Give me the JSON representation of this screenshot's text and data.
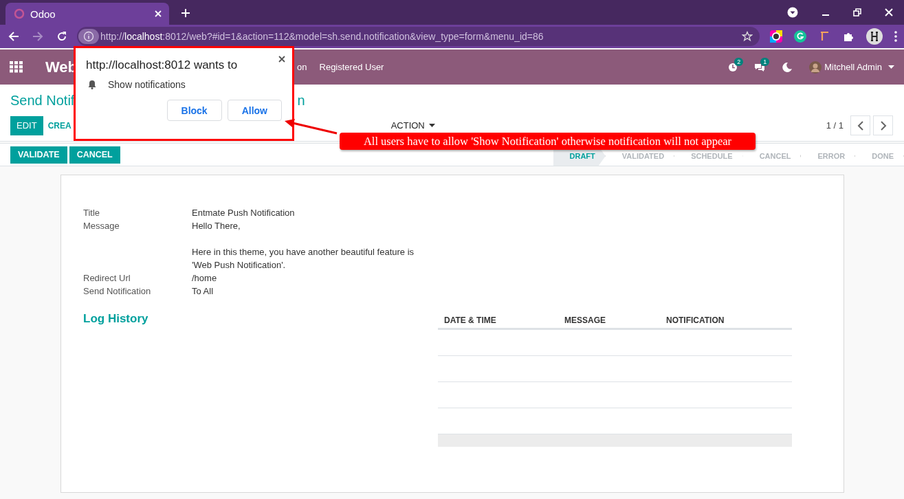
{
  "browser": {
    "tab_title": "Odoo",
    "url_host": "localhost",
    "url_rest": ":8012/web?#id=1&action=112&model=sh.send.notification&view_type=form&menu_id=86",
    "url_scheme": "http://"
  },
  "navbar": {
    "app_name": "Web",
    "menu_items": [
      "on",
      "Registered User"
    ],
    "activity_count": "2",
    "message_count": "1",
    "user": "Mitchell Admin"
  },
  "control_panel": {
    "breadcrumb": [
      "Send Notif",
      "n"
    ],
    "buttons": [
      "EDIT",
      "CREA"
    ],
    "action": "ACTION",
    "pager": "1 / 1"
  },
  "statusbar": {
    "buttons": [
      "VALIDATE",
      "CANCEL"
    ],
    "stages": [
      {
        "label": "DRAFT",
        "selected": true
      },
      {
        "label": "VALIDATED",
        "selected": false
      },
      {
        "label": "SCHEDULE",
        "selected": false
      },
      {
        "label": "CANCEL",
        "selected": false
      },
      {
        "label": "ERROR",
        "selected": false
      },
      {
        "label": "DONE",
        "selected": false
      }
    ]
  },
  "form": {
    "fields": [
      {
        "label": "Title",
        "lines": [
          "Entmate Push Notification"
        ]
      },
      {
        "label": "Message",
        "lines": [
          "Hello There,",
          "Here in this theme, you have another beautiful feature is 'Web Push Notification'."
        ]
      },
      {
        "label": "Redirect Url",
        "lines": [
          "/home"
        ]
      },
      {
        "label": "Send Notification",
        "lines": [
          "To All"
        ]
      }
    ],
    "log_history": {
      "title": "Log History",
      "columns": [
        "DATE & TIME",
        "MESSAGE",
        "NOTIFICATION"
      ]
    }
  },
  "permission_popup": {
    "title": "http://localhost:8012 wants to",
    "permission": "Show notifications",
    "buttons": [
      "Block",
      "Allow"
    ]
  },
  "callout": {
    "text": "All users have to allow 'Show Notification' otherwise notification will not appear"
  }
}
